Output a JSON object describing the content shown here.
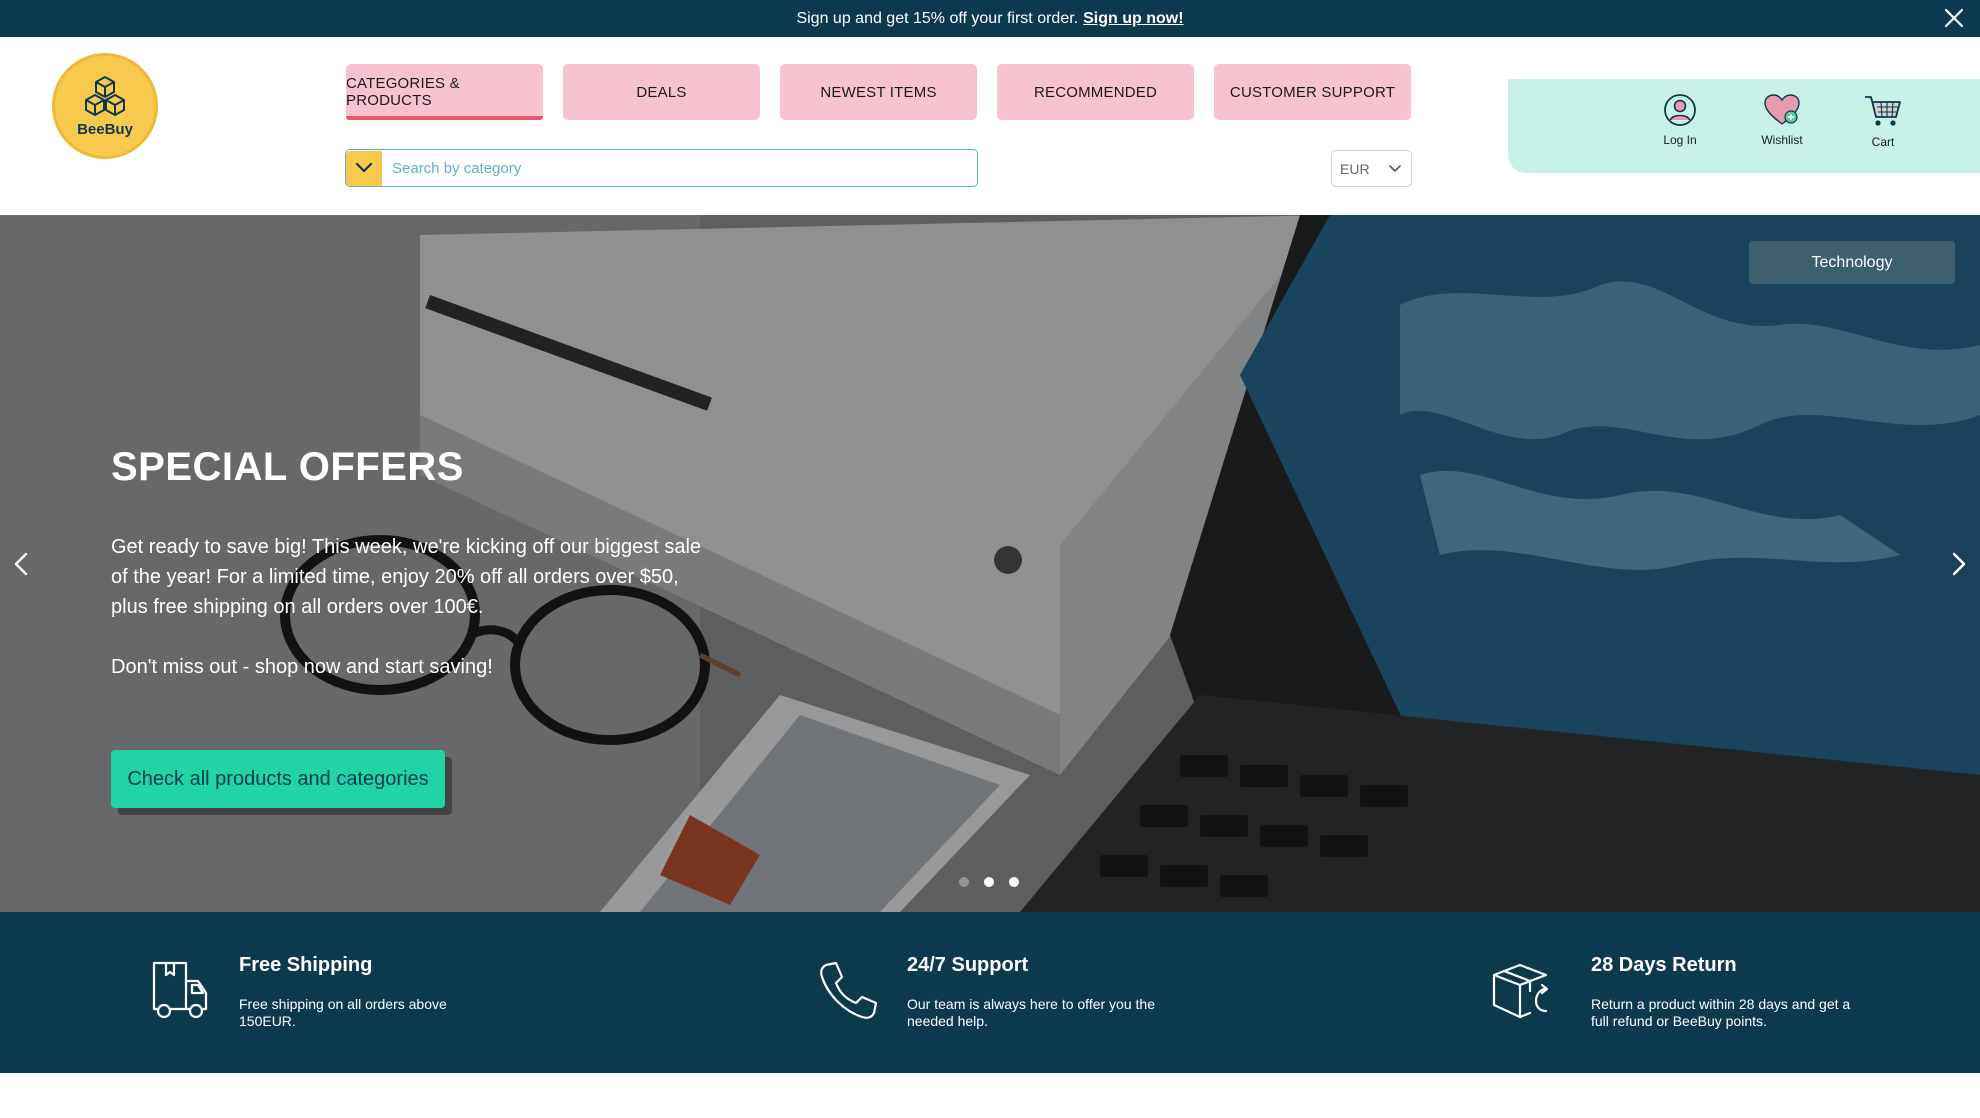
{
  "promo": {
    "text": "Sign up and get 15% off your first order.",
    "link": "Sign up now!"
  },
  "brand": {
    "name": "BeeBuy",
    "color": "#f7c94c"
  },
  "nav": {
    "items": [
      {
        "label": "CATEGORIES & PRODUCTS",
        "active": true
      },
      {
        "label": "DEALS",
        "active": false
      },
      {
        "label": "NEWEST ITEMS",
        "active": false
      },
      {
        "label": "RECOMMENDED",
        "active": false
      },
      {
        "label": "CUSTOMER SUPPORT",
        "active": false
      }
    ]
  },
  "search": {
    "placeholder": "Search by category",
    "value": ""
  },
  "currency": {
    "selected": "EUR"
  },
  "account": {
    "login": "Log In",
    "wishlist": "Wishlist",
    "cart": "Cart"
  },
  "hero": {
    "tag": "Technology",
    "title": "SPECIAL OFFERS",
    "paragraph1": "Get ready to save big! This week, we're kicking off our biggest sale of the year! For a limited time, enjoy 20% off all orders over $50, plus  free shipping on all orders over 100€.",
    "paragraph2": "Don't miss out - shop now and start saving!",
    "cta": "Check all products and categories",
    "slides": 3,
    "active_slide": 2
  },
  "features": [
    {
      "icon": "truck-icon",
      "title": "Free Shipping",
      "desc": "Free shipping on all orders above 150EUR."
    },
    {
      "icon": "phone-icon",
      "title": "24/7 Support",
      "desc": "Our team is always here to offer you the needed help."
    },
    {
      "icon": "return-box-icon",
      "title": "28 Days Return",
      "desc": "Return a product within 28 days and get a full refund or BeeBuy points."
    }
  ],
  "colors": {
    "navy": "#0b3a4e",
    "pink": "#f9c2d1",
    "pink_accent": "#e8566e",
    "mint": "#c8f2e7",
    "cta_green": "#20d4a5",
    "yellow": "#f7c94c"
  }
}
